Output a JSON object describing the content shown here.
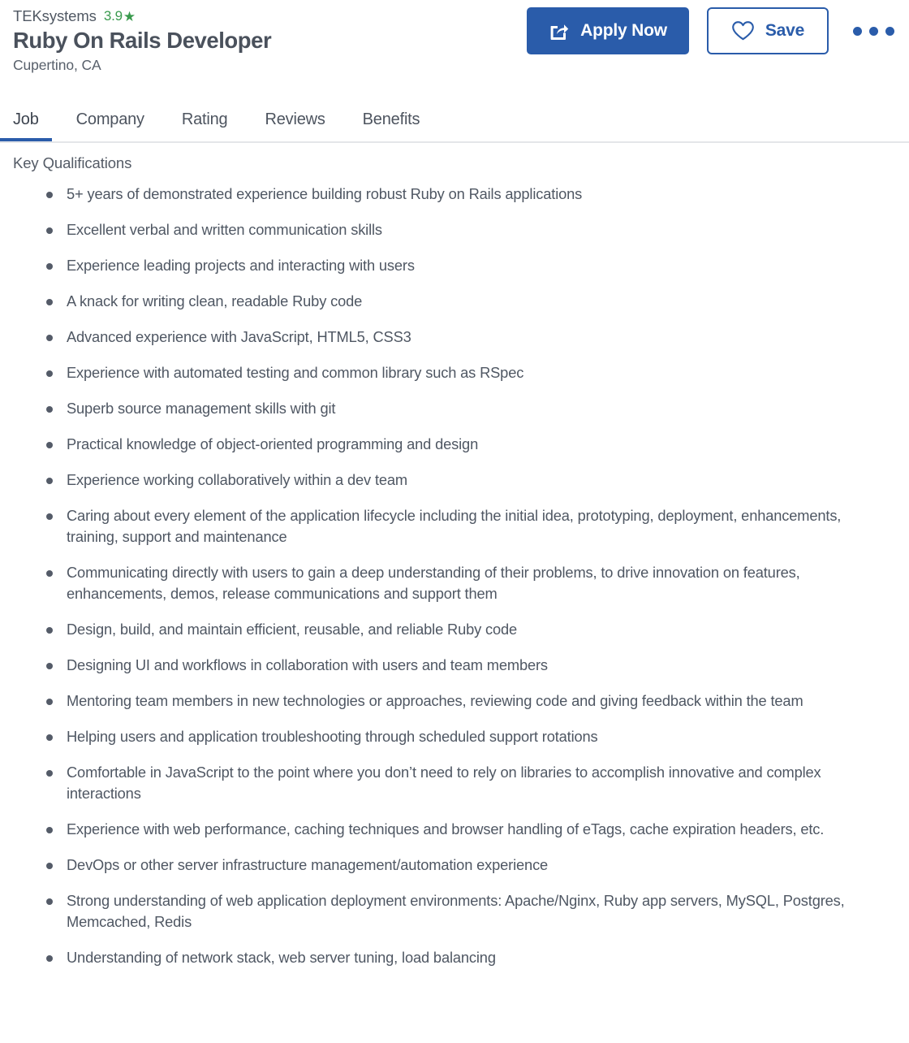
{
  "header": {
    "company": "TEKsystems",
    "rating": "3.9",
    "star_icon": "star-icon",
    "job_title": "Ruby On Rails Developer",
    "location": "Cupertino, CA"
  },
  "actions": {
    "apply_label": "Apply Now",
    "apply_icon": "share-external-icon",
    "save_label": "Save",
    "save_icon": "heart-icon",
    "more_label": "",
    "more_icon": "more-horizontal-icon",
    "accent_color": "#2a5caa"
  },
  "tabs": [
    {
      "label": "Job",
      "active": true
    },
    {
      "label": "Company",
      "active": false
    },
    {
      "label": "Rating",
      "active": false
    },
    {
      "label": "Reviews",
      "active": false
    },
    {
      "label": "Benefits",
      "active": false
    }
  ],
  "main": {
    "section_heading": "Key Qualifications",
    "qualifications": [
      "5+ years of demonstrated experience building robust Ruby on Rails applications",
      "Excellent verbal and written communication skills",
      "Experience leading projects and interacting with users",
      "A knack for writing clean, readable Ruby code",
      "Advanced experience with JavaScript, HTML5, CSS3",
      "Experience with automated testing and common library such as RSpec",
      "Superb source management skills with git",
      "Practical knowledge of object-oriented programming and design",
      "Experience working collaboratively within a dev team",
      "Caring about every element of the application lifecycle including the initial idea, prototyping, deployment, enhancements, training, support and maintenance",
      "Communicating directly with users to gain a deep understanding of their problems, to drive innovation on features, enhancements, demos, release communications and support them",
      "Design, build, and maintain efficient, reusable, and reliable Ruby code",
      "Designing UI and workflows in collaboration with users and team members",
      "Mentoring team members in new technologies or approaches, reviewing code and giving feedback within the team",
      "Helping users and application troubleshooting through scheduled support rotations",
      "Comfortable in JavaScript to the point where you don’t need to rely on libraries to accomplish innovative and complex interactions",
      "Experience with web performance, caching techniques and browser handling of eTags, cache expiration headers, etc.",
      "DevOps or other server infrastructure management/automation experience",
      "Strong understanding of web application deployment environments: Apache/Nginx, Ruby app servers, MySQL, Postgres, Memcached, Redis",
      "Understanding of network stack, web server tuning, load balancing"
    ]
  }
}
